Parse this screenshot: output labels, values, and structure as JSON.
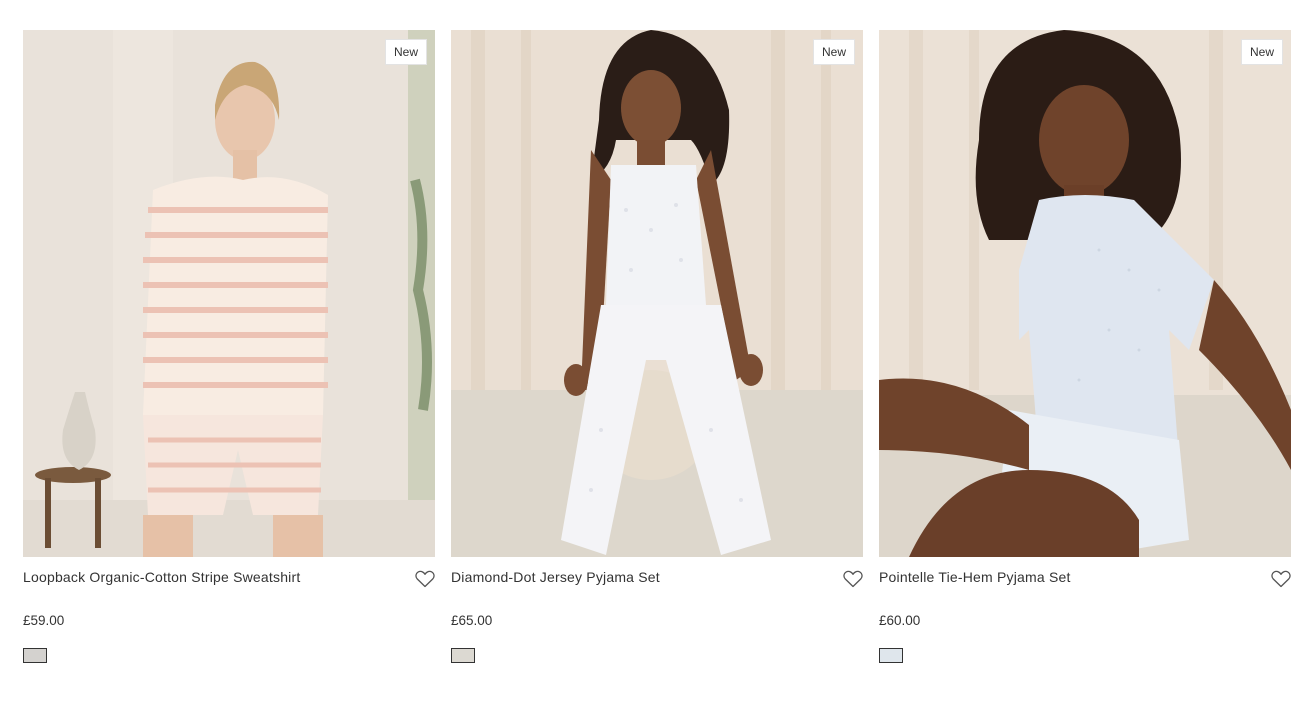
{
  "products": [
    {
      "badge": "New",
      "name": "Loopback Organic-Cotton Stripe Sweatshirt",
      "price": "£59.00",
      "swatch_color": "#d4d2cf",
      "image_label": "Woman in pink striped sweatshirt and shorts"
    },
    {
      "badge": "New",
      "name": "Diamond-Dot Jersey Pyjama Set",
      "price": "£65.00",
      "swatch_color": "#dcd9d2",
      "image_label": "Woman in white camisole and pyjama trousers"
    },
    {
      "badge": "New",
      "name": "Pointelle Tie-Hem Pyjama Set",
      "price": "£60.00",
      "swatch_color": "#dfe6ec",
      "image_label": "Woman in pale blue pointelle t-shirt and shorts"
    }
  ],
  "icons": {
    "wishlist": "heart-outline-icon"
  }
}
